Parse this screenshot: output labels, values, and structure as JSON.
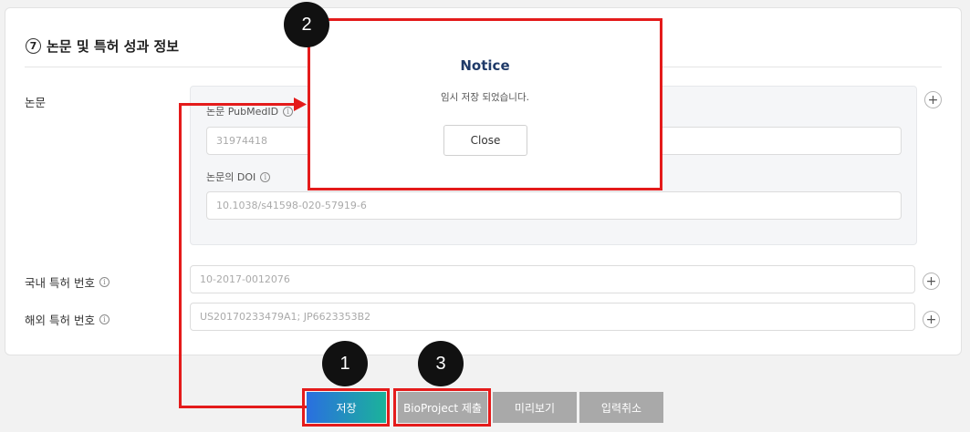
{
  "section": {
    "number": "7",
    "title": "논문 및 특허 성과 정보"
  },
  "paper": {
    "label": "논문",
    "pubmed_label": "논문 PubMedID",
    "pubmed_placeholder": "31974418",
    "doi_label": "논문의 DOI",
    "doi_placeholder": "10.1038/s41598-020-57919-6"
  },
  "patent_domestic": {
    "label": "국내 특허 번호",
    "placeholder": "10-2017-0012076"
  },
  "patent_foreign": {
    "label": "해외 특허 번호",
    "placeholder": "US20170233479A1; JP6623353B2"
  },
  "icons": {
    "info": "i",
    "plus": "+"
  },
  "modal": {
    "title": "Notice",
    "message": "임시 저장 되었습니다.",
    "close_label": "Close"
  },
  "steps": [
    "1",
    "2",
    "3"
  ],
  "buttons": {
    "save": "저장",
    "bioproject": "BioProject 제출",
    "preview": "미리보기",
    "cancel": "입력취소"
  },
  "colors": {
    "highlight": "#e41b1b",
    "modal_title": "#1f3a68",
    "save_gradient_start": "#2a6fe0",
    "save_gradient_end": "#1bb39a",
    "gray_button": "#a9a9a9"
  }
}
